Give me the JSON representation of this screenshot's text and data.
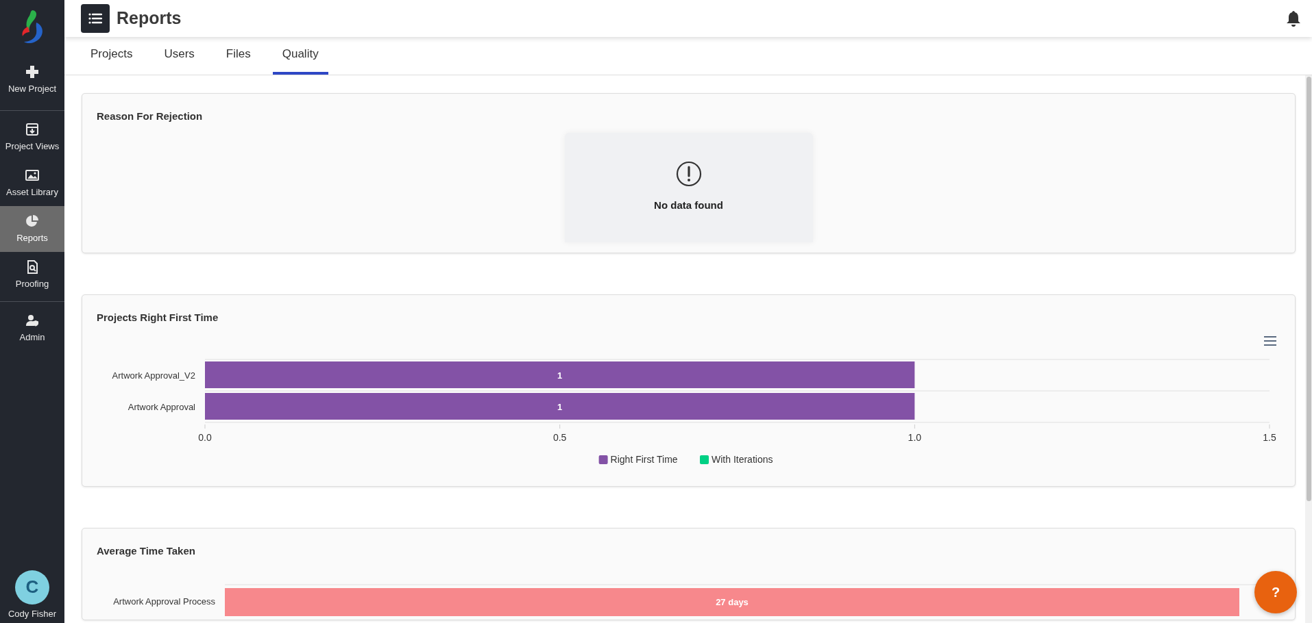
{
  "sidebar": {
    "groups": [
      {
        "items": [
          {
            "label": "New Project",
            "selected": false
          }
        ]
      },
      {
        "items": [
          {
            "label": "Project Views",
            "selected": false
          },
          {
            "label": "Asset Library",
            "selected": false
          },
          {
            "label": "Reports",
            "selected": true
          },
          {
            "label": "Proofing",
            "selected": false
          }
        ]
      },
      {
        "items": [
          {
            "label": "Admin",
            "selected": false
          }
        ]
      }
    ],
    "user": {
      "initial": "C",
      "name": "Cody Fisher"
    }
  },
  "header": {
    "title": "Reports"
  },
  "tabs": [
    {
      "label": "Projects",
      "selected": false
    },
    {
      "label": "Users",
      "selected": false
    },
    {
      "label": "Files",
      "selected": false
    },
    {
      "label": "Quality",
      "selected": true
    }
  ],
  "cards": [
    {
      "kind": "empty",
      "title": "Reason For Rejection",
      "message": "No data found"
    },
    {
      "kind": "chart",
      "title": "Projects Right First Time",
      "chart_data": {
        "type": "bar",
        "orientation": "horizontal",
        "stacked": true,
        "data_labels": true,
        "categories": [
          "Artwork Approval_V2",
          "Artwork Approval"
        ],
        "xlim": [
          0,
          1.5
        ],
        "xticks": [
          {
            "value": 0,
            "label": "0.0"
          },
          {
            "value": 0.5,
            "label": "0.5"
          },
          {
            "value": 1,
            "label": "1.0"
          },
          {
            "value": 1.5,
            "label": "1.5"
          }
        ],
        "series": [
          {
            "name": "Right First Time",
            "color": "#8352a6",
            "values": [
              1,
              1
            ]
          },
          {
            "name": "With Iterations",
            "color": "#00d084",
            "values": [
              null,
              null
            ]
          }
        ]
      }
    },
    {
      "kind": "bar_list",
      "title": "Average Time Taken",
      "rows": [
        {
          "label": "Artwork Approval Process",
          "bar_text": "27 days"
        }
      ]
    }
  ],
  "help_button": {
    "label": "?"
  }
}
